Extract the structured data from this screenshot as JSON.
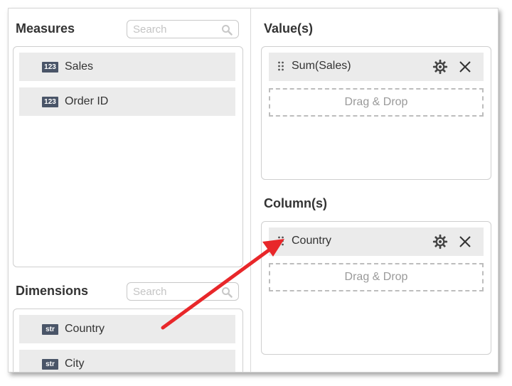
{
  "measures": {
    "title": "Measures",
    "search_placeholder": "Search",
    "items": [
      {
        "badge": "123",
        "label": "Sales"
      },
      {
        "badge": "123",
        "label": "Order ID"
      }
    ]
  },
  "dimensions": {
    "title": "Dimensions",
    "search_placeholder": "Search",
    "items": [
      {
        "badge": "str",
        "label": "Country"
      },
      {
        "badge": "str",
        "label": "City"
      }
    ]
  },
  "values": {
    "title": "Value(s)",
    "field": "Sum(Sales)",
    "drop_label": "Drag & Drop"
  },
  "columns": {
    "title": "Column(s)",
    "field": "Country",
    "drop_label": "Drag & Drop"
  },
  "icons": {
    "search": "search-icon",
    "grip": "drag-handle-icon",
    "settings": "gear-icon",
    "remove": "close-icon"
  },
  "colors": {
    "arrow": "#e8272a",
    "badge": "#4a5568",
    "field_bg": "#ebebeb"
  }
}
